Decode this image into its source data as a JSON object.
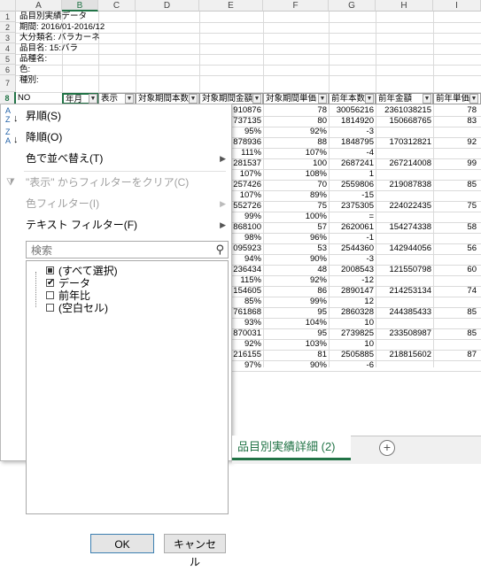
{
  "column_headers": [
    "A",
    "B",
    "C",
    "D",
    "E",
    "F",
    "G",
    "H",
    "I"
  ],
  "row_headers": [
    "1",
    "2",
    "3",
    "4",
    "5",
    "6",
    "7",
    "8"
  ],
  "info": {
    "line1": "品目別実績データ",
    "line2": "期間: 2016/01-2016/12",
    "line3": "大分類名: バラカーネ",
    "line4": "品目名:    15:バラ",
    "line5": "品種名:",
    "line6": "色:",
    "line7": "種別:"
  },
  "table_headers": {
    "no": "NO",
    "year": "年月",
    "display": "表示",
    "qty": "対象期間本数",
    "amount": "対象期間金額",
    "unit": "対象期間単価",
    "prev_qty": "前年本数",
    "prev_amount": "前年金額",
    "prev_unit": "前年単価"
  },
  "rows": [
    [
      "910876",
      "78",
      "30056216",
      "2361038215",
      "78"
    ],
    [
      "737135",
      "80",
      "1814920",
      "150668765",
      "83"
    ],
    [
      "95%",
      "92%",
      "-3",
      "",
      ""
    ],
    [
      "878936",
      "88",
      "1848795",
      "170312821",
      "92"
    ],
    [
      "111%",
      "107%",
      "-4",
      "",
      ""
    ],
    [
      "281537",
      "100",
      "2687241",
      "267214008",
      "99"
    ],
    [
      "107%",
      "108%",
      "1",
      "",
      ""
    ],
    [
      "257426",
      "70",
      "2559806",
      "219087838",
      "85"
    ],
    [
      "107%",
      "89%",
      "-15",
      "",
      ""
    ],
    [
      "552726",
      "75",
      "2375305",
      "224022435",
      "75"
    ],
    [
      "99%",
      "100%",
      "=",
      "",
      ""
    ],
    [
      "868100",
      "57",
      "2620061",
      "154274338",
      "58"
    ],
    [
      "98%",
      "96%",
      "-1",
      "",
      ""
    ],
    [
      "095923",
      "53",
      "2544360",
      "142944056",
      "56"
    ],
    [
      "94%",
      "90%",
      "-3",
      "",
      ""
    ],
    [
      "236434",
      "48",
      "2008543",
      "121550798",
      "60"
    ],
    [
      "115%",
      "92%",
      "-12",
      "",
      ""
    ],
    [
      "154605",
      "86",
      "2890147",
      "214253134",
      "74"
    ],
    [
      "85%",
      "99%",
      "12",
      "",
      ""
    ],
    [
      "761868",
      "95",
      "2860328",
      "244385433",
      "85"
    ],
    [
      "93%",
      "104%",
      "10",
      "",
      ""
    ],
    [
      "870031",
      "95",
      "2739825",
      "233508987",
      "85"
    ],
    [
      "92%",
      "103%",
      "10",
      "",
      ""
    ],
    [
      "216155",
      "81",
      "2505885",
      "218815602",
      "87"
    ],
    [
      "97%",
      "90%",
      "-6",
      "",
      ""
    ]
  ],
  "menu": {
    "sort_asc": "昇順(S)",
    "sort_desc": "降順(O)",
    "sort_by_color": "色で並べ替え(T)",
    "clear_filter": "\"表示\" からフィルターをクリア(C)",
    "color_filter": "色フィルター(I)",
    "text_filter": "テキスト フィルター(F)",
    "search_placeholder": "検索",
    "items": [
      {
        "label": "(すべて選択)",
        "state": "partial"
      },
      {
        "label": "データ",
        "state": "checked"
      },
      {
        "label": "前年比",
        "state": "unchecked"
      },
      {
        "label": "(空白セル)",
        "state": "unchecked"
      }
    ],
    "ok_label": "OK",
    "cancel_label": "キャンセル"
  },
  "sheet_tab": "品目別実績詳細 (2)",
  "add_sheet_symbol": "+",
  "icons": [
    "sort-ascending-icon",
    "sort-descending-icon",
    "clear-filter-icon",
    "search-icon",
    "submenu-arrow-icon",
    "filter-dropdown-icon"
  ],
  "colors": {
    "accent": "#217346",
    "grid": "#dadada",
    "header_bg": "#f0f0f0"
  }
}
